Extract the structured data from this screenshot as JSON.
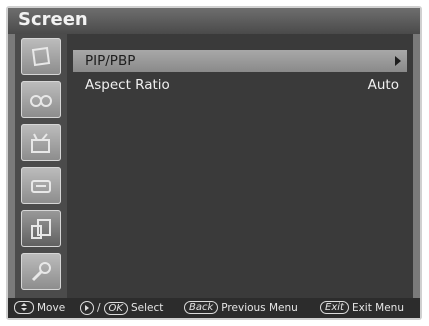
{
  "title": "Screen",
  "sidebar": {
    "items": [
      {
        "icon": "picture-icon",
        "active": false
      },
      {
        "icon": "sound-icon",
        "active": false
      },
      {
        "icon": "channel-icon",
        "active": false
      },
      {
        "icon": "timer-icon",
        "active": false
      },
      {
        "icon": "screen-icon",
        "active": true
      },
      {
        "icon": "setup-icon",
        "active": false
      }
    ]
  },
  "menu": {
    "items": [
      {
        "label": "PIP/PBP",
        "value": "",
        "selected": true,
        "has_submenu": true
      },
      {
        "label": "Aspect Ratio",
        "value": "Auto",
        "selected": false,
        "has_submenu": false
      }
    ]
  },
  "footer": {
    "move_label": "Move",
    "select_sep": "/",
    "ok_key": "OK",
    "select_label": "Select",
    "back_key": "Back",
    "back_label": "Previous Menu",
    "exit_key": "Exit",
    "exit_label": "Exit Menu"
  },
  "colors": {
    "frame": "#7a7a7a",
    "panel": "#3a3a3a",
    "highlight": "#9a9a9a",
    "text": "#f0f0f0"
  }
}
